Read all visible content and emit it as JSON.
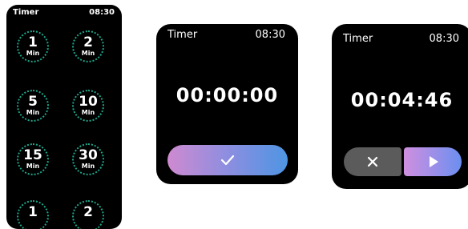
{
  "screens": [
    {
      "title": "Timer",
      "clock": "08:30",
      "presets": [
        {
          "value": "1",
          "unit": "Min"
        },
        {
          "value": "2",
          "unit": "Min"
        },
        {
          "value": "5",
          "unit": "Min"
        },
        {
          "value": "10",
          "unit": "Min"
        },
        {
          "value": "15",
          "unit": "Min"
        },
        {
          "value": "30",
          "unit": "Min"
        },
        {
          "value": "1",
          "unit": ""
        },
        {
          "value": "2",
          "unit": ""
        }
      ]
    },
    {
      "title": "Timer",
      "clock": "08:30",
      "time": "00:00:00"
    },
    {
      "title": "Timer",
      "clock": "08:30",
      "time": "00:04:46"
    }
  ],
  "colors": {
    "preset_ring": "#1fa58a",
    "gradient_start": "#cf8ad0",
    "gradient_end": "#4e95e3",
    "cancel_bg": "#5b5b5b"
  },
  "icons": {
    "confirm": "check-icon",
    "cancel": "close-icon",
    "play": "play-icon"
  }
}
